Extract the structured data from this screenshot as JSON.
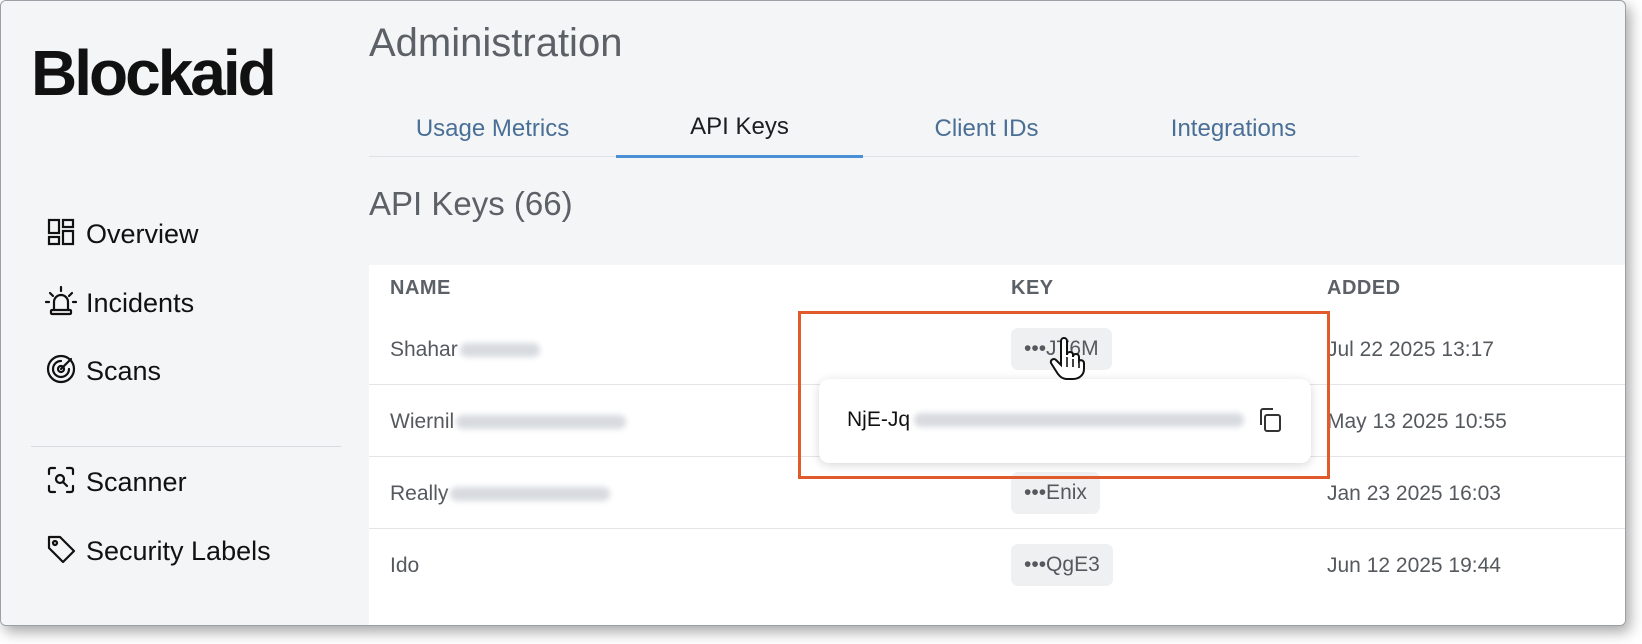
{
  "brand": {
    "logo_text": "Blockaid"
  },
  "sidebar": {
    "items": [
      {
        "label": "Overview",
        "icon": "dashboard-icon"
      },
      {
        "label": "Incidents",
        "icon": "siren-icon"
      },
      {
        "label": "Scans",
        "icon": "radar-icon"
      },
      {
        "label": "Scanner",
        "icon": "scan-search-icon"
      },
      {
        "label": "Security Labels",
        "icon": "tag-icon"
      }
    ]
  },
  "page": {
    "title": "Administration",
    "tabs": [
      {
        "label": "Usage Metrics",
        "active": false
      },
      {
        "label": "API Keys",
        "active": true
      },
      {
        "label": "Client IDs",
        "active": false
      },
      {
        "label": "Integrations",
        "active": false
      }
    ],
    "section_title": "API Keys (66)"
  },
  "table": {
    "columns": [
      "NAME",
      "KEY",
      "ADDED"
    ],
    "rows": [
      {
        "name": "Shahar",
        "key": "•••JT6M",
        "added": "Jul 22 2025 13:17"
      },
      {
        "name": "Wiernil",
        "key": "",
        "added": "May 13 2025 10:55"
      },
      {
        "name": "Really",
        "key": "•••Enix",
        "added": "Jan 23 2025 16:03"
      },
      {
        "name": "Ido",
        "key": "•••QgE3",
        "added": "Jun 12 2025 19:44"
      }
    ]
  },
  "popover": {
    "key_prefix": "NjE-Jq",
    "copy_icon": "copy-icon"
  },
  "colors": {
    "accent": "#4b8fd6",
    "highlight": "#e05a2b",
    "tab_text": "#4a6f96"
  }
}
